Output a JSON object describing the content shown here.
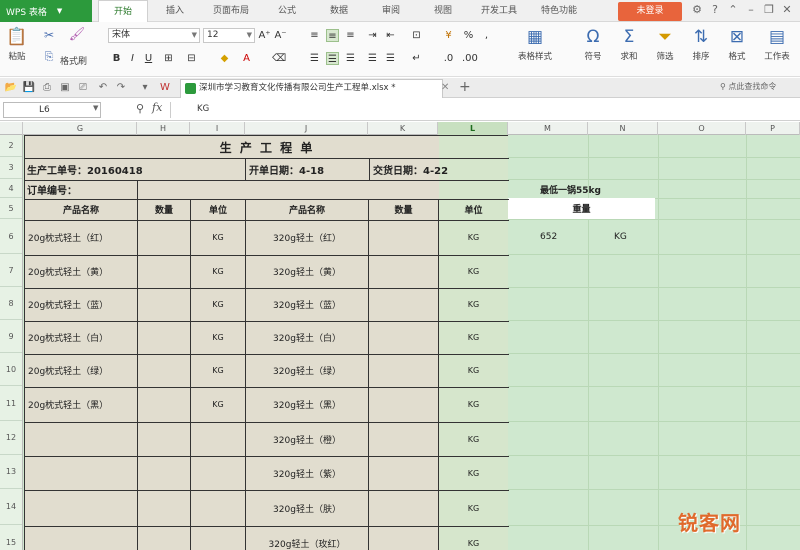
{
  "app": {
    "name": "WPS 表格"
  },
  "ribbon": {
    "tabs": [
      "开始",
      "插入",
      "页面布局",
      "公式",
      "数据",
      "审阅",
      "视图",
      "开发工具",
      "特色功能"
    ],
    "active_tab": "开始",
    "login_label": "未登录"
  },
  "toolbar": {
    "paste": "粘贴",
    "format_painter": "格式刷",
    "font_name": "宋体",
    "font_size": "12",
    "table_style": "表格样式",
    "symbol": "符号",
    "sum": "求和",
    "filter": "筛选",
    "sort": "排序",
    "format": "格式",
    "worksheet": "工作表"
  },
  "doc_tab": {
    "title": "深圳市学习教育文化传播有限公司生产工程单.xlsx *"
  },
  "command_search": "点此查找命令",
  "formula_bar": {
    "cell_ref": "L6",
    "content": "KG"
  },
  "columns": [
    "G",
    "H",
    "I",
    "J",
    "K",
    "L",
    "M",
    "N",
    "O",
    "P"
  ],
  "selected_column": "L",
  "rows": [
    "2",
    "3",
    "4",
    "5",
    "6",
    "7",
    "8",
    "9",
    "10",
    "11",
    "12",
    "13",
    "14",
    "15"
  ],
  "form": {
    "title": "生 产 工 程 单",
    "order_no": "生产工单号：20160418",
    "open_date": "开单日期：4-18",
    "delivery_date": "交货日期：4-22",
    "order_code_label": "订单编号：",
    "headers": [
      "产品名称",
      "数量",
      "单位",
      "产品名称",
      "数量",
      "单位"
    ],
    "items": [
      {
        "left_name": "20g枕式轻土（红）",
        "left_unit": "KG",
        "right_name": "320g轻土（红）",
        "right_unit": "KG"
      },
      {
        "left_name": "20g枕式轻土（黄）",
        "left_unit": "KG",
        "right_name": "320g轻土（黄）",
        "right_unit": "KG"
      },
      {
        "left_name": "20g枕式轻土（蓝）",
        "left_unit": "KG",
        "right_name": "320g轻土（蓝）",
        "right_unit": "KG"
      },
      {
        "left_name": "20g枕式轻土（白）",
        "left_unit": "KG",
        "right_name": "320g轻土（白）",
        "right_unit": "KG"
      },
      {
        "left_name": "20g枕式轻土（绿）",
        "left_unit": "KG",
        "right_name": "320g轻土（绿）",
        "right_unit": "KG"
      },
      {
        "left_name": "20g枕式轻土（黑）",
        "left_unit": "KG",
        "right_name": "320g轻土（黑）",
        "right_unit": "KG"
      },
      {
        "left_name": "",
        "left_unit": "",
        "right_name": "320g轻土（橙）",
        "right_unit": "KG"
      },
      {
        "left_name": "",
        "left_unit": "",
        "right_name": "320g轻土（紫）",
        "right_unit": "KG"
      },
      {
        "left_name": "",
        "left_unit": "",
        "right_name": "320g轻土（肤）",
        "right_unit": "KG"
      },
      {
        "left_name": "",
        "left_unit": "",
        "right_name": "320g轻土（玫红）",
        "right_unit": "KG"
      }
    ]
  },
  "side": {
    "min_pot": "最低一锅55kg",
    "weight_header": "重量",
    "weight_value": "652",
    "weight_unit": "KG"
  },
  "watermark": "锐客网"
}
